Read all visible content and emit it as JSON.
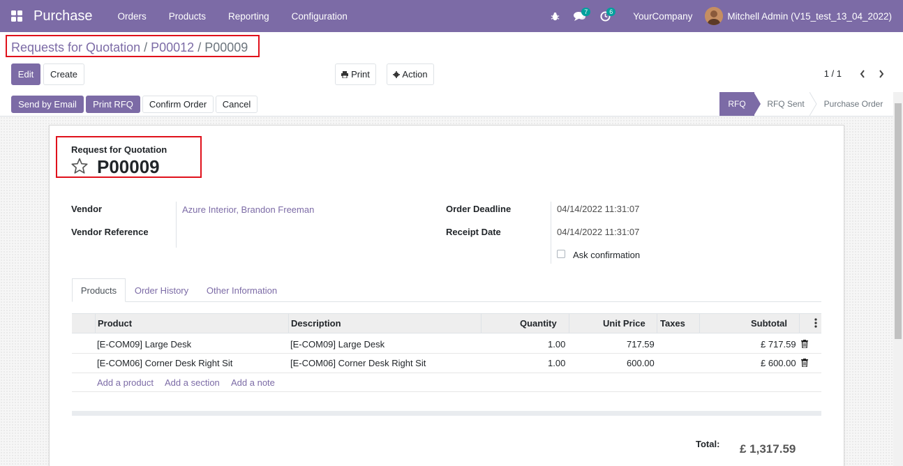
{
  "navbar": {
    "app_name": "Purchase",
    "menu": [
      "Orders",
      "Products",
      "Reporting",
      "Configuration"
    ],
    "messages_count": "7",
    "activities_count": "6",
    "company": "YourCompany",
    "user": "Mitchell Admin (V15_test_13_04_2022)",
    "color": "#7c6ba6"
  },
  "breadcrumb": {
    "items": [
      "Requests for Quotation",
      "P00012",
      "P00009"
    ],
    "separator": "/"
  },
  "control": {
    "edit_label": "Edit",
    "create_label": "Create",
    "print_label": "Print",
    "action_label": "Action",
    "pager": "1 / 1"
  },
  "statusbar": {
    "buttons": [
      "Send by Email",
      "Print RFQ",
      "Confirm Order",
      "Cancel"
    ],
    "stages": [
      "RFQ",
      "RFQ Sent",
      "Purchase Order"
    ],
    "active_stage": "RFQ"
  },
  "form": {
    "subtitle": "Request for Quotation",
    "name": "P00009",
    "fields_left": [
      {
        "label": "Vendor",
        "value": "Azure Interior, Brandon Freeman"
      },
      {
        "label": "Vendor Reference",
        "value": ""
      }
    ],
    "fields_right": [
      {
        "label": "Order Deadline",
        "value": "04/14/2022 11:31:07"
      },
      {
        "label": "Receipt Date",
        "value": "04/14/2022 11:31:07"
      }
    ],
    "ask_confirmation_label": "Ask confirmation",
    "ask_confirmation_checked": false
  },
  "tabs": [
    "Products",
    "Order History",
    "Other Information"
  ],
  "active_tab": "Products",
  "lines": {
    "columns": [
      "Product",
      "Description",
      "Quantity",
      "Unit Price",
      "Taxes",
      "Subtotal"
    ],
    "rows": [
      {
        "product": "[E-COM09] Large Desk",
        "description": "[E-COM09] Large Desk",
        "quantity": "1.00",
        "unit_price": "717.59",
        "taxes": "",
        "subtotal": "£ 717.59"
      },
      {
        "product": "[E-COM06] Corner Desk Right Sit",
        "description": "[E-COM06] Corner Desk Right Sit",
        "quantity": "1.00",
        "unit_price": "600.00",
        "taxes": "",
        "subtotal": "£ 600.00"
      }
    ],
    "add_links": [
      "Add a product",
      "Add a section",
      "Add a note"
    ]
  },
  "totals": {
    "label": "Total:",
    "value": "£ 1,317.59"
  }
}
